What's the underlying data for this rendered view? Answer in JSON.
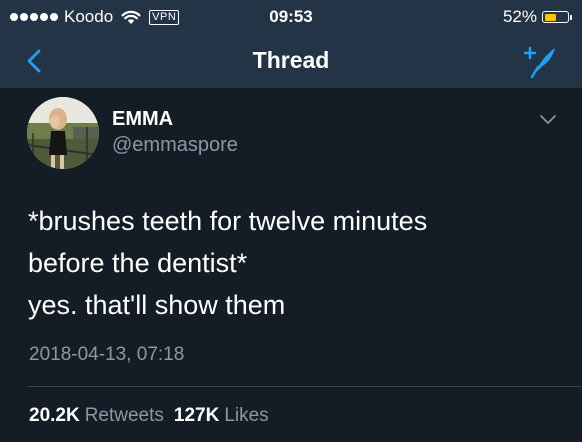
{
  "status_bar": {
    "carrier": "Koodo",
    "vpn": "VPN",
    "time": "09:53",
    "battery": "52%",
    "battery_level": 0.52,
    "battery_color": "#f7c600"
  },
  "nav": {
    "title": "Thread",
    "back_icon": "chevron-left-icon",
    "compose_icon": "compose-tweet-icon",
    "accent": "#1da1f2"
  },
  "tweet": {
    "name": "EMMA",
    "handle": "@emmaspore",
    "lines": [
      "*brushes teeth for twelve minutes",
      "before the dentist*",
      "yes. that'll show them"
    ],
    "timestamp": "2018-04-13, 07:18"
  },
  "stats": {
    "retweets_count": "20.2K",
    "retweets_label": "Retweets",
    "likes_count": "127K",
    "likes_label": "Likes"
  }
}
